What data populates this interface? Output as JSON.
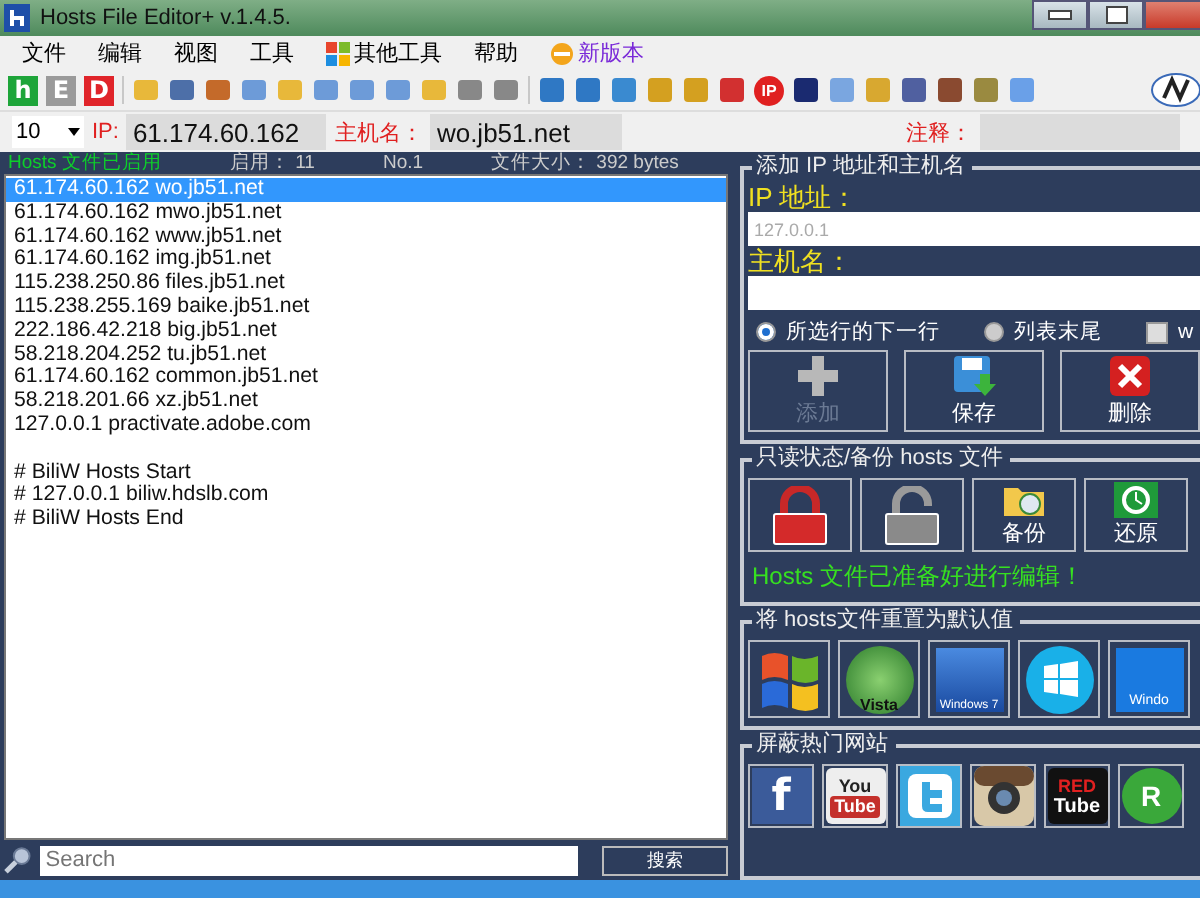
{
  "window": {
    "title": "Hosts File Editor+ v.1.4.5."
  },
  "menu": [
    {
      "label": "文件",
      "kind": "plain"
    },
    {
      "label": "编辑",
      "kind": "plain"
    },
    {
      "label": "视图",
      "kind": "plain"
    },
    {
      "label": "工具",
      "kind": "plain"
    },
    {
      "label": "其他工具",
      "kind": "windows"
    },
    {
      "label": "帮助",
      "kind": "plain"
    },
    {
      "label": "新版本",
      "kind": "update"
    }
  ],
  "toolbar": {
    "letters": [
      {
        "text": "h",
        "color": "#1ea53a"
      },
      {
        "text": "E",
        "color": "#9a9a9a"
      },
      {
        "text": "D",
        "color": "#e0242a"
      }
    ],
    "ip_badge": "IP"
  },
  "entry_row": {
    "count": "10",
    "ip_label": "IP:",
    "ip_value": "61.174.60.162",
    "host_label": "主机名：",
    "host_value": "wo.jb51.net",
    "note_label": "注释："
  },
  "info_strip": [
    "Hosts 文件已启用",
    "启用： 11",
    "No.1",
    "文件大小： 392 bytes"
  ],
  "hosts_list": [
    {
      "text": "61.174.60.162 wo.jb51.net",
      "kind": "line",
      "selected": true
    },
    {
      "text": "61.174.60.162 mwo.jb51.net",
      "kind": "line",
      "selected": false
    },
    {
      "text": "61.174.60.162 www.jb51.net",
      "kind": "line",
      "selected": false
    },
    {
      "text": "61.174.60.162 img.jb51.net",
      "kind": "line",
      "selected": false
    },
    {
      "text": "115.238.250.86 files.jb51.net",
      "kind": "line",
      "selected": false
    },
    {
      "text": "115.238.255.169 baike.jb51.net",
      "kind": "line",
      "selected": false
    },
    {
      "text": "222.186.42.218 big.jb51.net",
      "kind": "line",
      "selected": false
    },
    {
      "text": "58.218.204.252 tu.jb51.net",
      "kind": "line",
      "selected": false
    },
    {
      "text": "61.174.60.162 common.jb51.net",
      "kind": "line",
      "selected": false
    },
    {
      "text": "58.218.201.66 xz.jb51.net",
      "kind": "line",
      "selected": false
    },
    {
      "text": "127.0.0.1 practivate.adobe.com",
      "kind": "line",
      "selected": false
    },
    {
      "kind": "blank",
      "selected": false
    },
    {
      "text": "# BiliW Hosts Start",
      "kind": "line",
      "selected": false
    },
    {
      "text": "# 127.0.0.1 biliw.hdslb.com",
      "kind": "line",
      "selected": false
    },
    {
      "text": "# BiliW Hosts End",
      "kind": "line",
      "selected": false
    }
  ],
  "search": {
    "placeholder": "Search",
    "button": "搜索"
  },
  "add_section": {
    "title": "添加 IP 地址和主机名",
    "ip_label": "IP 地址：",
    "ip_placeholder": "127.0.0.1",
    "host_label": "主机名：",
    "position_options": [
      {
        "label": "所选行的下一行",
        "selected": true
      },
      {
        "label": "列表末尾",
        "selected": false
      }
    ],
    "checkbox": {
      "label": "w",
      "checked": false
    },
    "buttons": [
      {
        "label": "添加",
        "kind": "add",
        "disabled": true
      },
      {
        "label": "保存",
        "kind": "save",
        "disabled": false
      },
      {
        "label": "删除",
        "kind": "delete",
        "disabled": false
      }
    ]
  },
  "backup_section": {
    "title": "只读状态/备份 hosts 文件",
    "buttons": [
      {
        "kind": "lock"
      },
      {
        "kind": "unlock"
      },
      {
        "kind": "backup",
        "label": "备份"
      },
      {
        "kind": "restore",
        "label": "还原"
      }
    ],
    "status": "Hosts 文件已准备好进行编辑！"
  },
  "reset_section": {
    "title": "将 hosts文件重置为默认值",
    "buttons": [
      {
        "kind": "xp"
      },
      {
        "kind": "vista",
        "label": "Vista"
      },
      {
        "kind": "win7",
        "label": "Windows 7"
      },
      {
        "kind": "win8"
      },
      {
        "kind": "win10",
        "label": "Windo"
      }
    ]
  },
  "block_section": {
    "title": "屏蔽热门网站",
    "sites": [
      {
        "kind": "facebook",
        "label": "f"
      },
      {
        "kind": "youtube",
        "label": "You",
        "label2": "Tube"
      },
      {
        "kind": "twitter"
      },
      {
        "kind": "instagram"
      },
      {
        "kind": "redtube",
        "label": "RED",
        "label2": "Tube"
      },
      {
        "kind": "green",
        "label": "R"
      }
    ]
  }
}
